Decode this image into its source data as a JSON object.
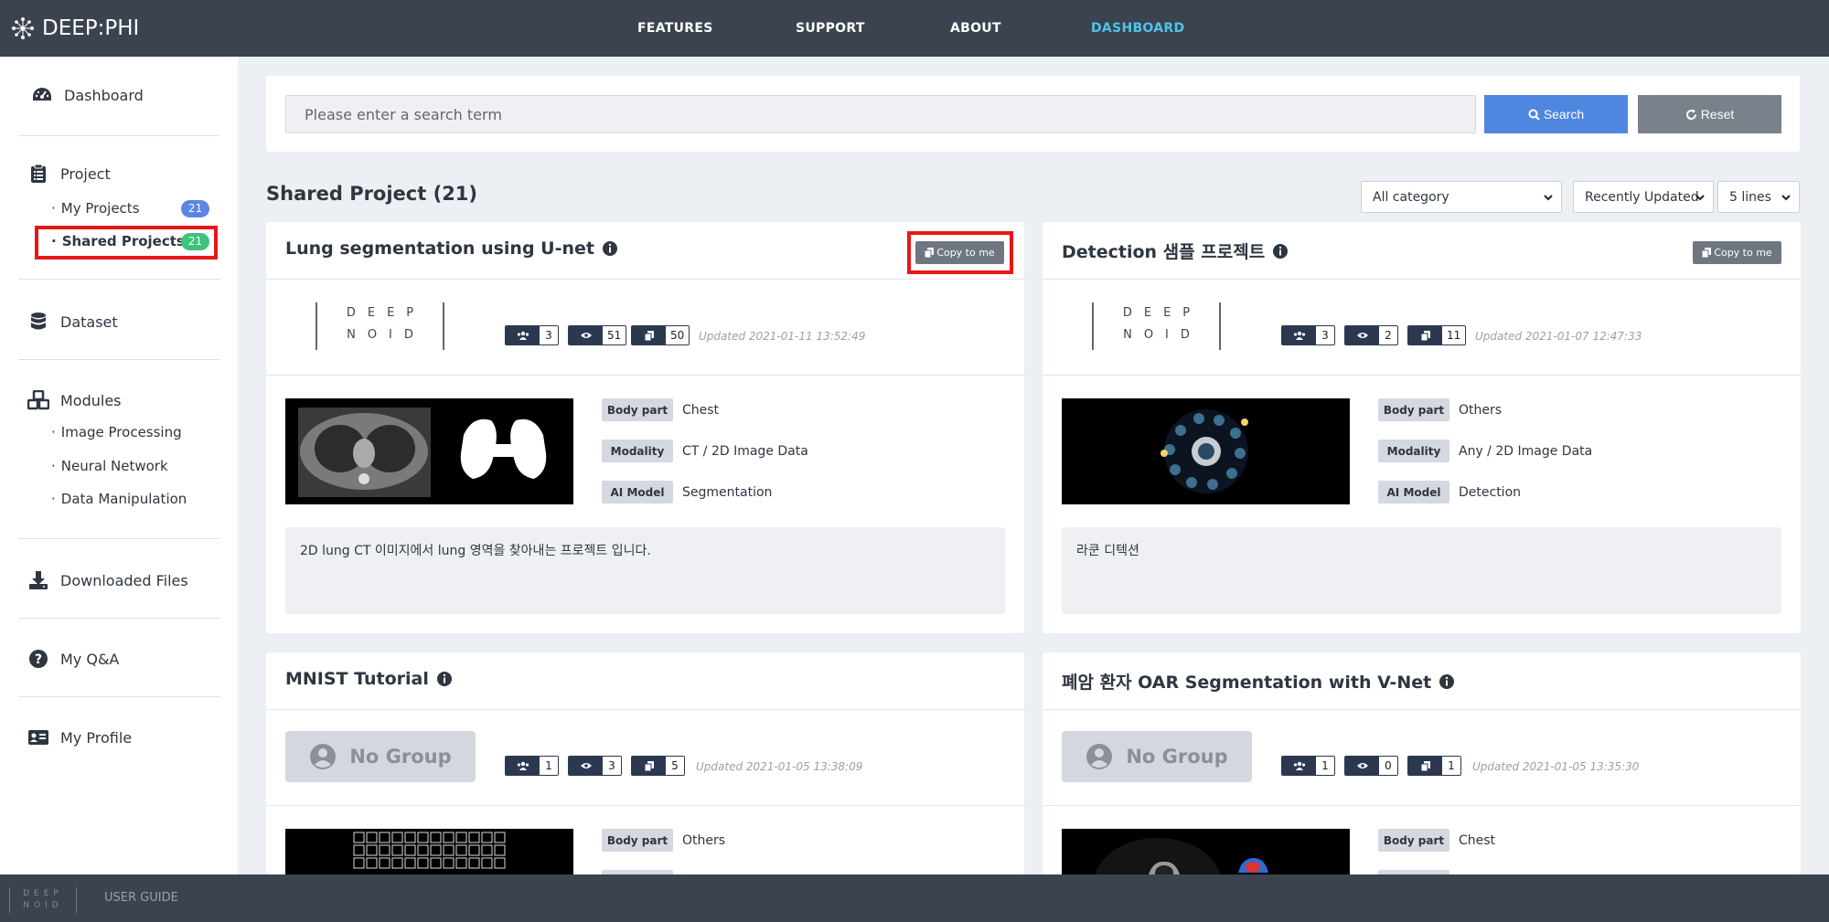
{
  "app": {
    "logo_text": "DEEP:PHI"
  },
  "nav": [
    {
      "label": "FEATURES"
    },
    {
      "label": "SUPPORT"
    },
    {
      "label": "ABOUT"
    },
    {
      "label": "DASHBOARD"
    }
  ],
  "sidebar": {
    "dashboard": "Dashboard",
    "project": "Project",
    "my_projects": "My Projects",
    "my_projects_count": "21",
    "shared_projects": "Shared Projects",
    "shared_projects_count": "21",
    "dataset": "Dataset",
    "modules": "Modules",
    "image_processing": "Image Processing",
    "neural_network": "Neural Network",
    "data_manipulation": "Data Manipulation",
    "downloaded_files": "Downloaded Files",
    "my_qa": "My Q&A",
    "my_profile": "My Profile"
  },
  "footer": {
    "logo_text": "DEEP NOID",
    "user_guide": "USER GUIDE"
  },
  "search": {
    "placeholder": "Please enter a search term",
    "search_label": "Search",
    "reset_label": "Reset"
  },
  "section": {
    "title": "Shared Project (21)",
    "category_select": "All category",
    "sort_select": "Recently Updated",
    "lines_select": "5 lines"
  },
  "cards": [
    {
      "title": "Lung segmentation using U-net",
      "copy_label": "Copy to me",
      "group": "DEEP NOID",
      "members": "3",
      "views": "51",
      "copies": "50",
      "updated": "Updated 2021-01-11 13:52:49",
      "body_part_label": "Body part",
      "body_part": "Chest",
      "modality_label": "Modality",
      "modality": "CT / 2D Image Data",
      "ai_model_label": "AI Model",
      "ai_model": "Segmentation",
      "description": "2D lung CT 이미지에서 lung 영역을 찾아내는 프로젝트 입니다."
    },
    {
      "title": "Detection 샘플 프로젝트",
      "copy_label": "Copy to me",
      "group": "DEEP NOID",
      "members": "3",
      "views": "2",
      "copies": "11",
      "updated": "Updated 2021-01-07 12:47:33",
      "body_part_label": "Body part",
      "body_part": "Others",
      "modality_label": "Modality",
      "modality": "Any / 2D Image Data",
      "ai_model_label": "AI Model",
      "ai_model": "Detection",
      "description": "라쿤 디텍션"
    },
    {
      "title": "MNIST Tutorial",
      "group": "No Group",
      "members": "1",
      "views": "3",
      "copies": "5",
      "updated": "Updated 2021-01-05 13:38:09",
      "body_part_label": "Body part",
      "body_part": "Others"
    },
    {
      "title": "폐암 환자 OAR Segmentation with V-Net",
      "group": "No Group",
      "members": "1",
      "views": "0",
      "copies": "1",
      "updated": "Updated 2021-01-05 13:35:30",
      "body_part_label": "Body part",
      "body_part": "Chest"
    }
  ],
  "colors": {
    "navbar": "#3c4350",
    "accent_nav": "#4fc3e8",
    "search_button": "#4f86e0",
    "reset_button": "#79818a",
    "badge_blue": "#5b86e5",
    "badge_green": "#3cc47c",
    "highlight": "#e81717",
    "stat_dark": "#2b3850"
  },
  "icons": [
    "logo-mark-icon",
    "dashboard-icon",
    "clipboard-icon",
    "database-icon",
    "cubes-icon",
    "download-icon",
    "question-icon",
    "id-card-icon",
    "search-icon",
    "refresh-icon",
    "info-icon",
    "copy-icon",
    "users-icon",
    "eye-icon",
    "files-icon",
    "user-circle-icon",
    "chevron-down-icon"
  ]
}
